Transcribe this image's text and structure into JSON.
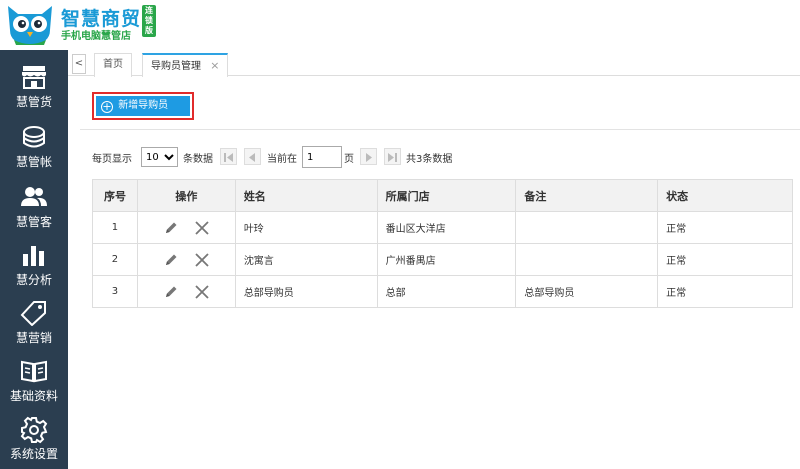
{
  "logo": {
    "title": "智慧商贸",
    "badge": "连锁版",
    "subtitle": "手机电脑慧管店"
  },
  "sidebar": {
    "items": [
      {
        "label": "慧管货",
        "icon": "store-icon"
      },
      {
        "label": "慧管帐",
        "icon": "coins-icon"
      },
      {
        "label": "慧管客",
        "icon": "users-icon"
      },
      {
        "label": "慧分析",
        "icon": "bar-chart-icon"
      },
      {
        "label": "慧营销",
        "icon": "tag-icon"
      },
      {
        "label": "基础资料",
        "icon": "book-icon"
      },
      {
        "label": "系统设置",
        "icon": "gear-icon"
      }
    ]
  },
  "tabs": {
    "prev": "<",
    "items": [
      {
        "label": "首页"
      },
      {
        "label": "导购员管理",
        "close": "×"
      }
    ]
  },
  "toolbar": {
    "add_label": "新增导购员",
    "add_icon": "+"
  },
  "pager": {
    "per_page_label": "每页显示",
    "per_page_value": "10",
    "per_page_unit": "条数据",
    "current_label": "当前在",
    "current_page": "1",
    "page_unit": "页",
    "total_text": "共3条数据"
  },
  "table": {
    "headers": [
      "序号",
      "操作",
      "姓名",
      "所属门店",
      "备注",
      "状态"
    ],
    "rows": [
      {
        "no": "1",
        "name": "叶玲",
        "store": "番山区大洋店",
        "remark": "",
        "status": "正常"
      },
      {
        "no": "2",
        "name": "沈寓言",
        "store": "广州番禺店",
        "remark": "",
        "status": "正常"
      },
      {
        "no": "3",
        "name": "总部导购员",
        "store": "总部",
        "remark": "总部导购员",
        "status": "正常"
      }
    ]
  },
  "colors": {
    "sidebar": "#2b3e50",
    "accent": "#1e9be3",
    "highlight": "#e12b2b",
    "brand_green": "#2aa64a"
  }
}
